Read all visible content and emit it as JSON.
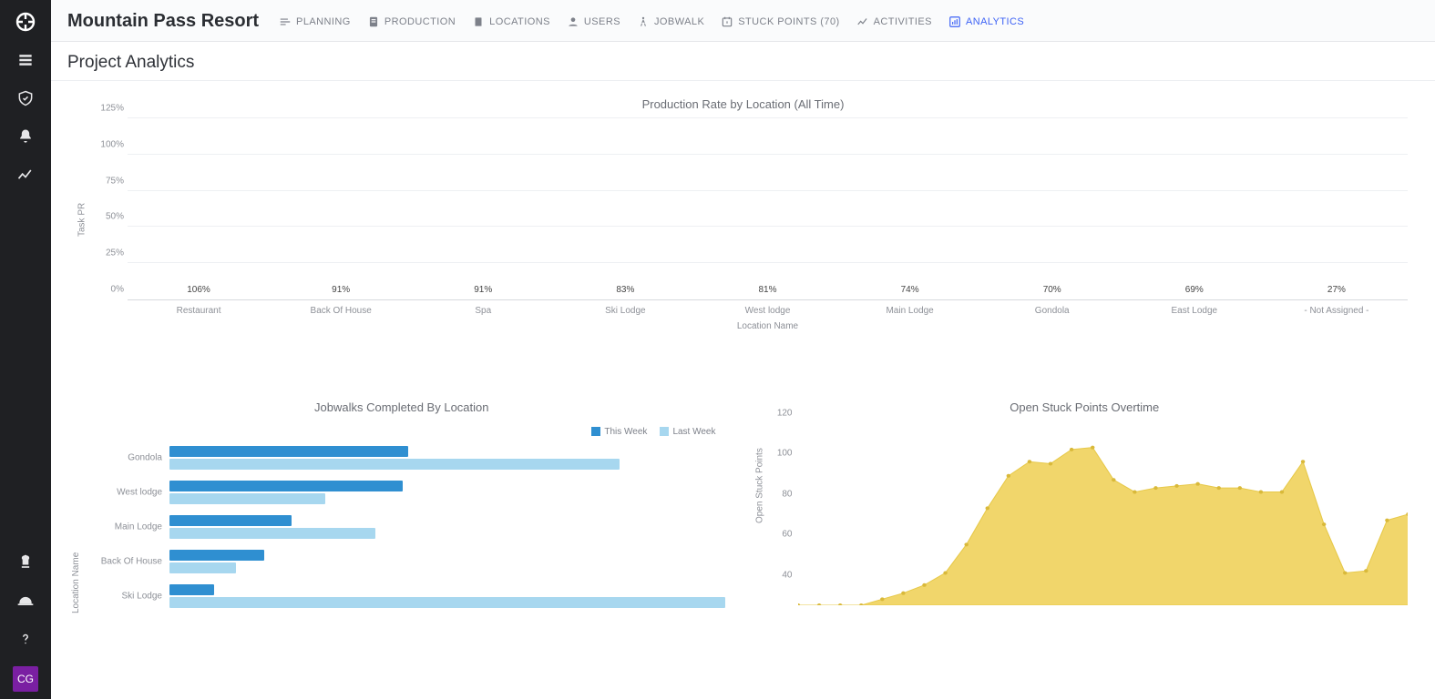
{
  "sidebar": {
    "avatar_initials": "CG"
  },
  "header": {
    "project_title": "Mountain Pass Resort",
    "tabs": [
      {
        "label": "PLANNING",
        "icon": "planning-icon",
        "active": false
      },
      {
        "label": "PRODUCTION",
        "icon": "production-icon",
        "active": false
      },
      {
        "label": "LOCATIONS",
        "icon": "locations-icon",
        "active": false
      },
      {
        "label": "USERS",
        "icon": "users-icon",
        "active": false
      },
      {
        "label": "JOBWALK",
        "icon": "jobwalk-icon",
        "active": false
      },
      {
        "label": "STUCK POINTS (70)",
        "icon": "stuck-points-icon",
        "active": false
      },
      {
        "label": "ACTIVITIES",
        "icon": "activities-icon",
        "active": false
      },
      {
        "label": "ANALYTICS",
        "icon": "analytics-icon",
        "active": true
      }
    ]
  },
  "page": {
    "title": "Project Analytics"
  },
  "charts": {
    "production_rate": {
      "title": "Production Rate by Location (All Time)",
      "ylabel": "Task PR",
      "xlabel": "Location Name",
      "y_ticks": [
        "0%",
        "25%",
        "50%",
        "75%",
        "100%",
        "125%"
      ]
    },
    "jobwalks": {
      "title": "Jobwalks Completed By Location",
      "ylabel": "Location Name",
      "legend": {
        "this_week": "This Week",
        "last_week": "Last Week"
      },
      "colors": {
        "this_week": "#2f8fd1",
        "last_week": "#a7d7ef"
      }
    },
    "stuck_points": {
      "title": "Open Stuck Points Overtime",
      "ylabel": "Open Stuck Points",
      "y_ticks": [
        "40",
        "60",
        "80",
        "100",
        "120"
      ]
    }
  },
  "chart_data": [
    {
      "id": "production_rate",
      "type": "bar",
      "title": "Production Rate by Location (All Time)",
      "xlabel": "Location Name",
      "ylabel": "Task PR",
      "ylim": [
        0,
        125
      ],
      "categories": [
        "Restaurant",
        "Back Of House",
        "Spa",
        "Ski Lodge",
        "West lodge",
        "Main Lodge",
        "Gondola",
        "East Lodge",
        "- Not Assigned -"
      ],
      "values": [
        106,
        91,
        91,
        83,
        81,
        74,
        70,
        69,
        27
      ],
      "value_labels": [
        "106%",
        "91%",
        "91%",
        "83%",
        "81%",
        "74%",
        "70%",
        "69%",
        "27%"
      ]
    },
    {
      "id": "jobwalks",
      "type": "bar_horizontal_grouped",
      "title": "Jobwalks Completed By Location",
      "ylabel": "Location Name",
      "xlim": [
        0,
        100
      ],
      "categories": [
        "Gondola",
        "West lodge",
        "Main Lodge",
        "Back Of House",
        "Ski Lodge"
      ],
      "series": [
        {
          "name": "This Week",
          "values": [
            43,
            42,
            22,
            17,
            8
          ]
        },
        {
          "name": "Last Week",
          "values": [
            81,
            28,
            37,
            12,
            100
          ]
        }
      ]
    },
    {
      "id": "stuck_points",
      "type": "area",
      "title": "Open Stuck Points Overtime",
      "ylabel": "Open Stuck Points",
      "ylim": [
        30,
        120
      ],
      "x": [
        0,
        1,
        2,
        3,
        4,
        5,
        6,
        7,
        8,
        9,
        10,
        11,
        12,
        13,
        14,
        15,
        16,
        17,
        18,
        19,
        20,
        21,
        22,
        23,
        24,
        25,
        26,
        27,
        28,
        29
      ],
      "values": [
        30,
        30,
        30,
        30,
        33,
        36,
        40,
        46,
        60,
        78,
        94,
        101,
        100,
        107,
        108,
        92,
        86,
        88,
        89,
        90,
        88,
        88,
        86,
        86,
        101,
        70,
        46,
        47,
        72,
        75
      ]
    }
  ]
}
